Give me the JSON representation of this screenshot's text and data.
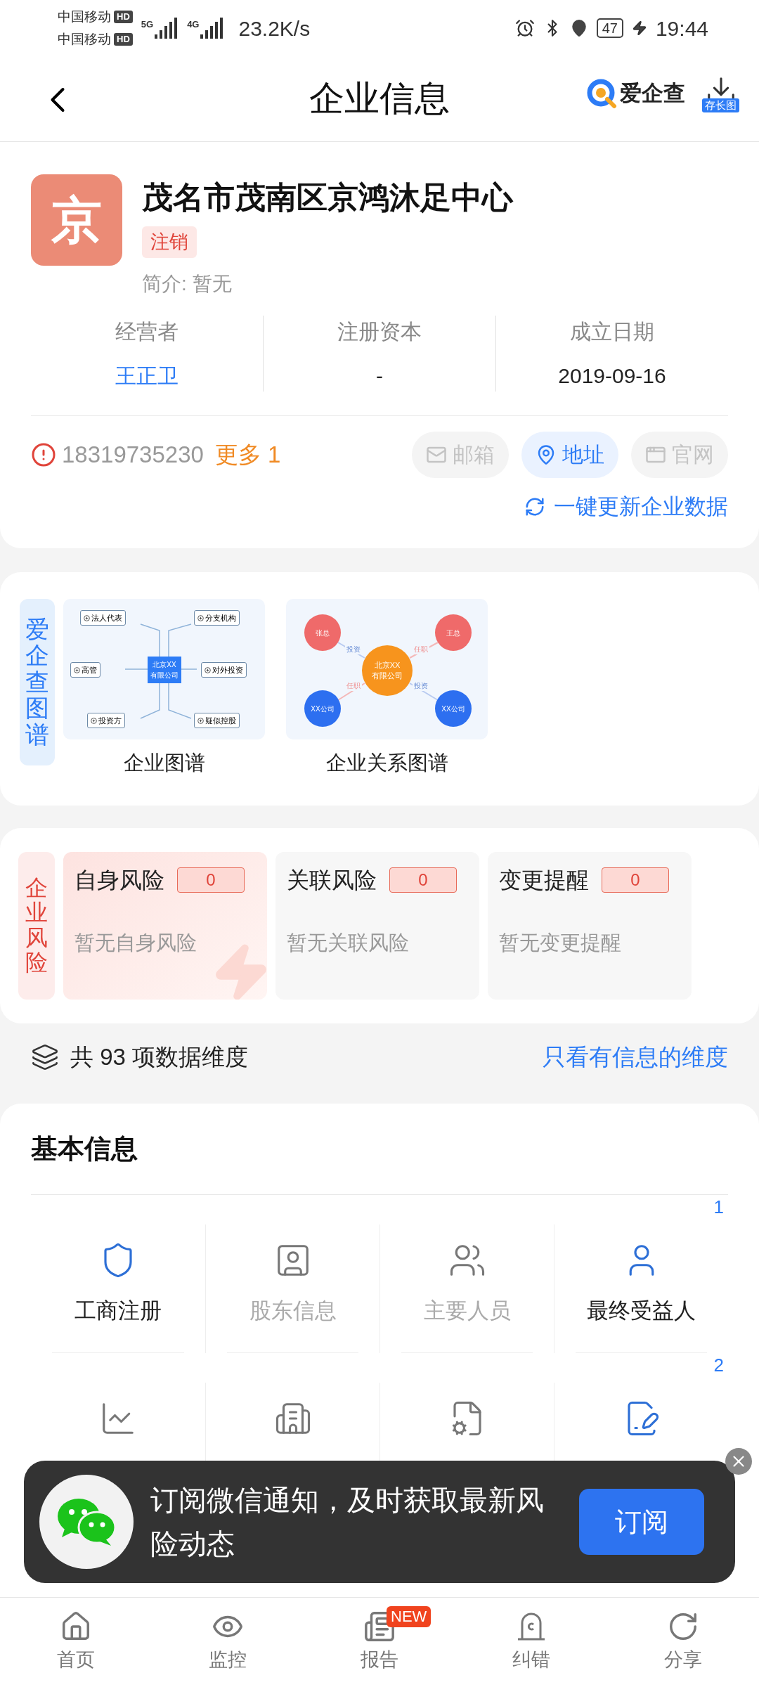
{
  "status_bar": {
    "carriers": [
      {
        "name": "中国移动",
        "hd": "HD"
      },
      {
        "name": "中国移动",
        "hd": "HD"
      }
    ],
    "networks": [
      "5G",
      "4G"
    ],
    "speed": "23.2K/s",
    "battery": "47",
    "time": "19:44"
  },
  "header": {
    "title": "企业信息",
    "brand": "爱企查",
    "save_badge": "存长图"
  },
  "company": {
    "logo_char": "京",
    "name": "茂名市茂南区京鸿沐足中心",
    "status": "注销",
    "intro_label": "简介:",
    "intro": "暂无"
  },
  "stats": [
    {
      "label": "经营者",
      "value": "王正卫",
      "kind": "link"
    },
    {
      "label": "注册资本",
      "value": "-",
      "kind": "plain"
    },
    {
      "label": "成立日期",
      "value": "2019-09-16",
      "kind": "plain"
    }
  ],
  "contact": {
    "phone": "18319735230",
    "more": "更多 1",
    "chips": [
      {
        "label": "邮箱",
        "kind": "mail",
        "enabled": false
      },
      {
        "label": "地址",
        "kind": "pin",
        "enabled": true
      },
      {
        "label": "官网",
        "kind": "web",
        "enabled": false
      }
    ],
    "update": "一键更新企业数据"
  },
  "graphs": {
    "side_label": "爱企查图谱",
    "tree": {
      "caption": "企业图谱",
      "center": [
        "北京XX",
        "有限公司"
      ],
      "nodes": [
        "法人代表",
        "分支机构",
        "高管",
        "对外投资",
        "投资方",
        "疑似控股"
      ]
    },
    "relation": {
      "caption": "企业关系图谱",
      "center": [
        "北京XX",
        "有限公司"
      ],
      "people": [
        "张总",
        "王总"
      ],
      "companies": [
        "XX公司",
        "XX公司"
      ],
      "edges": [
        "投资",
        "任职",
        "任职",
        "投资"
      ]
    }
  },
  "risk": {
    "side_label": "企业风险",
    "cards": [
      {
        "title": "自身风险",
        "count": "0",
        "empty": "暂无自身风险",
        "highlighted": true
      },
      {
        "title": "关联风险",
        "count": "0",
        "empty": "暂无关联风险",
        "highlighted": false
      },
      {
        "title": "变更提醒",
        "count": "0",
        "empty": "暂无变更提醒",
        "highlighted": false
      }
    ]
  },
  "dimensions": {
    "text": "共 93 项数据维度",
    "link": "只看有信息的维度"
  },
  "basic": {
    "title": "基本信息",
    "items": [
      {
        "label": "工商注册",
        "kind": "shield",
        "active": true
      },
      {
        "label": "股东信息",
        "kind": "profile",
        "active": false
      },
      {
        "label": "主要人员",
        "kind": "people",
        "active": false
      },
      {
        "label": "最终受益人",
        "kind": "beneficiary",
        "active": true,
        "badge": "1"
      },
      {
        "kind": "chart",
        "active": false
      },
      {
        "kind": "building",
        "active": false
      },
      {
        "kind": "refresh-doc",
        "active": false
      },
      {
        "kind": "edit",
        "active": true,
        "badge": "2"
      }
    ]
  },
  "toast": {
    "text": "订阅微信通知，及时获取最新风险动态",
    "button": "订阅"
  },
  "nav": [
    {
      "label": "首页",
      "kind": "home"
    },
    {
      "label": "监控",
      "kind": "eye"
    },
    {
      "label": "报告",
      "kind": "report",
      "badge": "NEW"
    },
    {
      "label": "纠错",
      "kind": "correct"
    },
    {
      "label": "分享",
      "kind": "share"
    }
  ]
}
